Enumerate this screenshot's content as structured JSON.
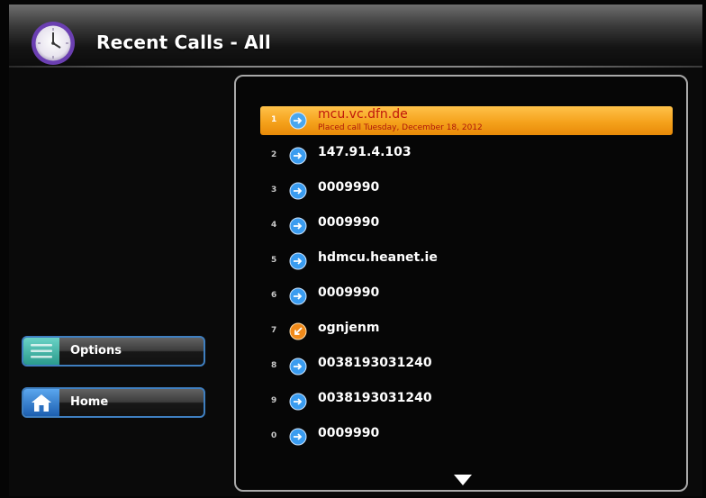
{
  "header": {
    "title": "Recent Calls - All",
    "icon": "clock-icon"
  },
  "side_menu": [
    {
      "label": "Options",
      "icon": "options-list-icon",
      "color": "#4fc4b5"
    },
    {
      "label": "Home",
      "icon": "home-icon",
      "color": "#3f8fe0"
    }
  ],
  "calls": [
    {
      "index": "1",
      "name": "mcu.vc.dfn.de",
      "detail": "Placed call Tuesday, December 18, 2012",
      "type": "outgoing",
      "selected": true
    },
    {
      "index": "2",
      "name": "147.91.4.103",
      "type": "outgoing"
    },
    {
      "index": "3",
      "name": "0009990",
      "type": "outgoing"
    },
    {
      "index": "4",
      "name": "0009990",
      "type": "outgoing"
    },
    {
      "index": "5",
      "name": "hdmcu.heanet.ie",
      "type": "outgoing"
    },
    {
      "index": "6",
      "name": "0009990",
      "type": "outgoing"
    },
    {
      "index": "7",
      "name": "ognjenm",
      "type": "missed"
    },
    {
      "index": "8",
      "name": "0038193031240",
      "type": "outgoing"
    },
    {
      "index": "9",
      "name": "0038193031240",
      "type": "outgoing"
    },
    {
      "index": "0",
      "name": "0009990",
      "type": "outgoing"
    }
  ],
  "colors": {
    "selected_row": "#f5a21c",
    "outgoing_icon": "#3aa0f0",
    "missed_icon": "#f08a1a",
    "button_border": "#3f7fc0"
  }
}
